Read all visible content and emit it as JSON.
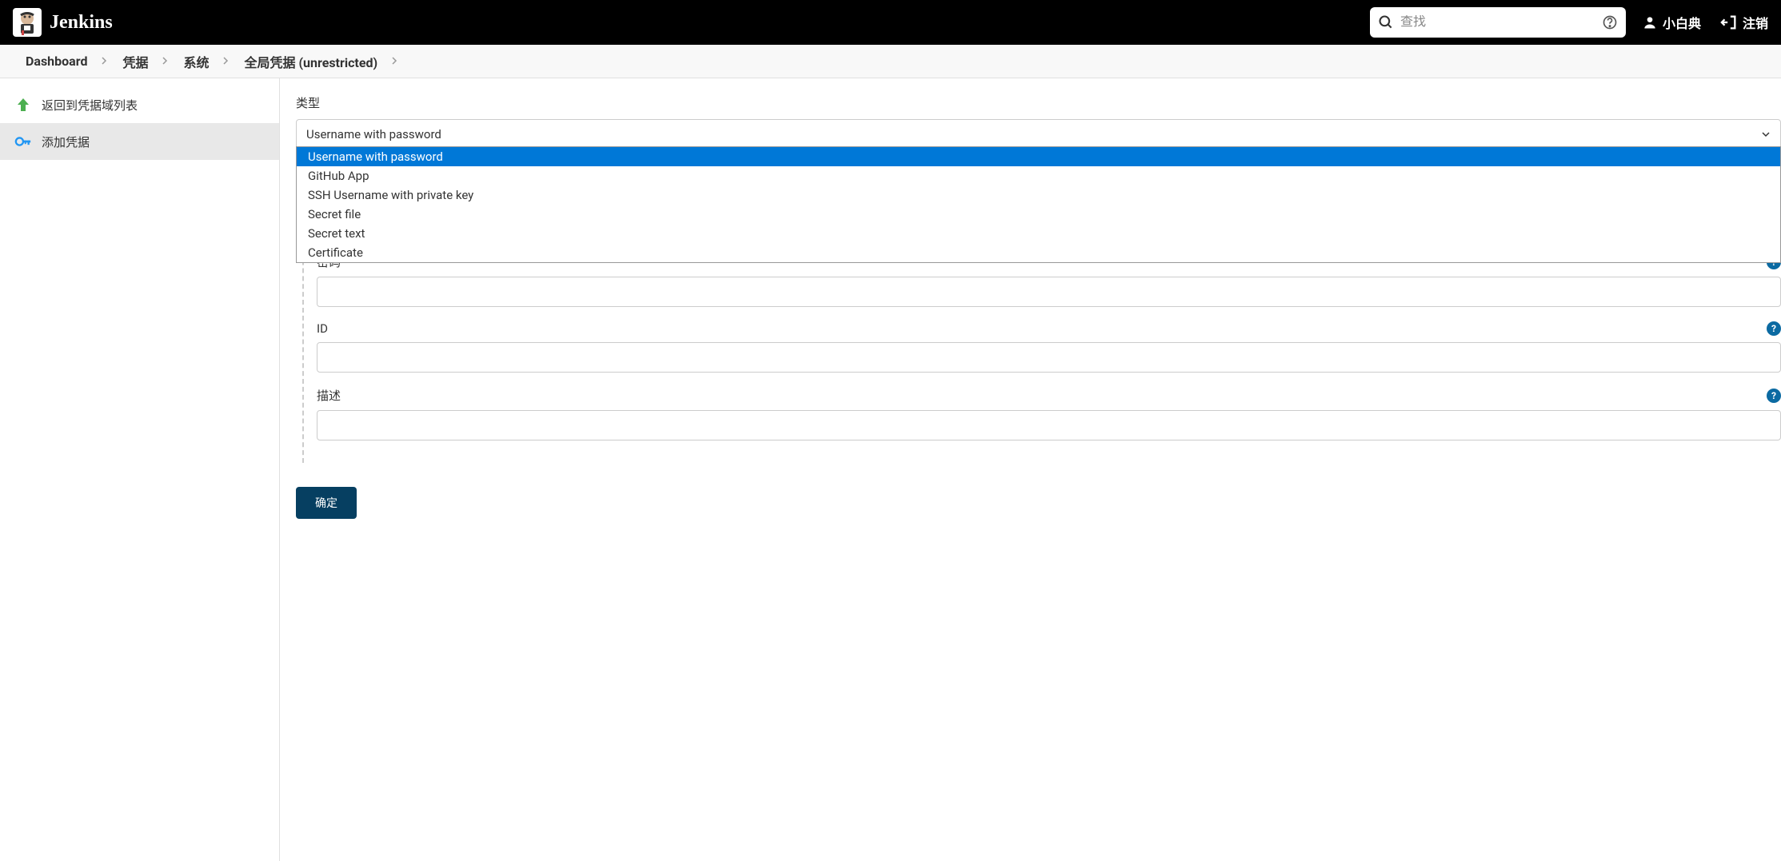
{
  "header": {
    "logo_text": "Jenkins",
    "search_placeholder": "查找",
    "username": "小白典",
    "logout_label": "注销"
  },
  "breadcrumb": {
    "items": [
      {
        "label": "Dashboard"
      },
      {
        "label": "凭据"
      },
      {
        "label": "系统"
      },
      {
        "label": "全局凭据 (unrestricted)"
      }
    ]
  },
  "sidebar": {
    "items": [
      {
        "label": "返回到凭据域列表",
        "icon": "arrow-up-green",
        "active": false
      },
      {
        "label": "添加凭据",
        "icon": "key-blue",
        "active": true
      }
    ]
  },
  "form": {
    "type_label": "类型",
    "type_selected": "Username with password",
    "type_options": [
      "Username with password",
      "GitHub App",
      "SSH Username with private key",
      "Secret file",
      "Secret text",
      "Certificate"
    ],
    "fields": {
      "password": {
        "label": "密码",
        "value": ""
      },
      "id": {
        "label": "ID",
        "value": ""
      },
      "description": {
        "label": "描述",
        "value": ""
      }
    },
    "submit_label": "确定"
  }
}
